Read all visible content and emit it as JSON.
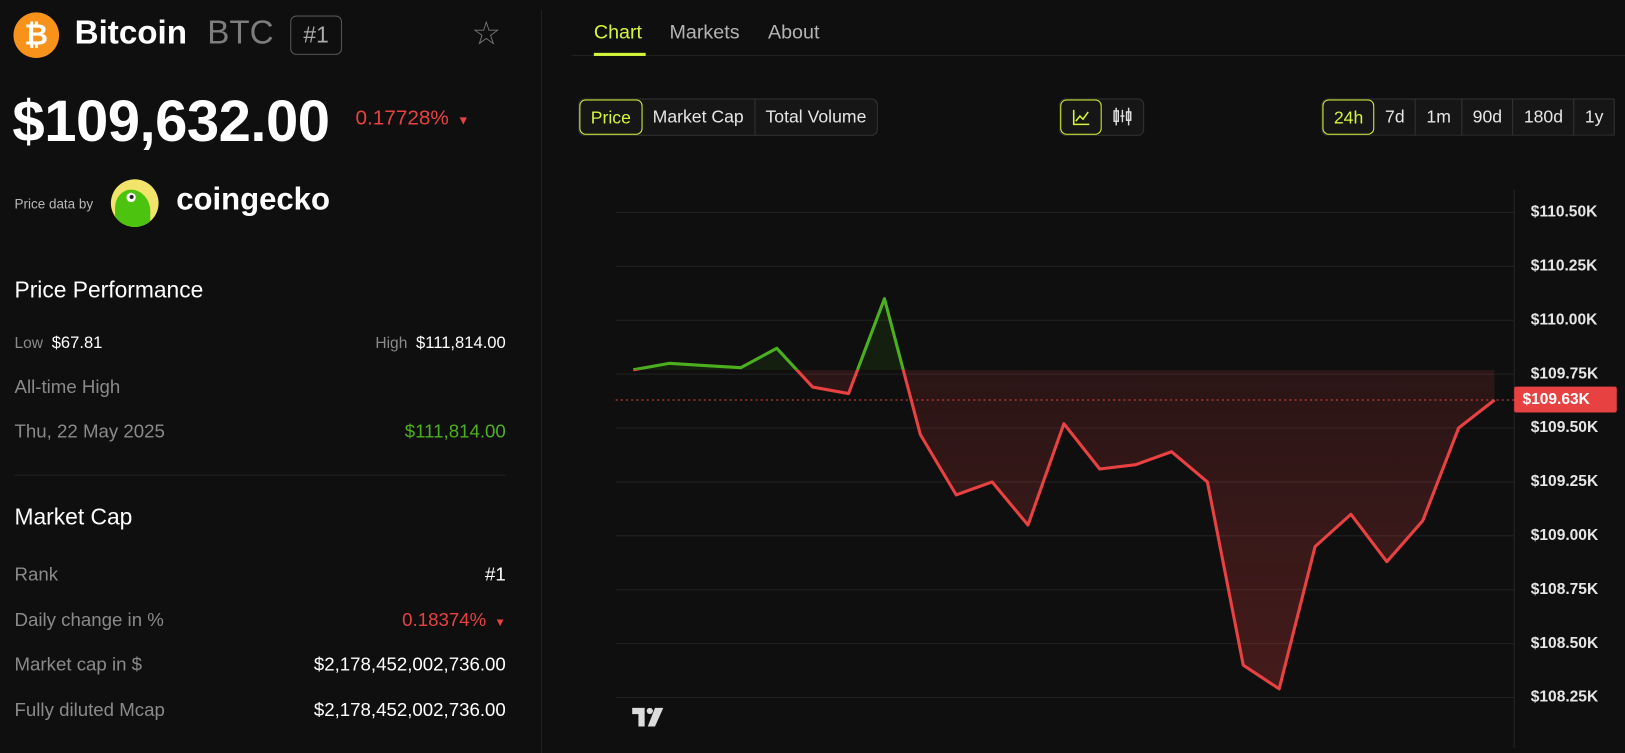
{
  "coin": {
    "name": "Bitcoin",
    "symbol": "BTC",
    "rank_badge": "#1",
    "icon": "bitcoin-icon",
    "favorite_icon": "star-icon"
  },
  "price": {
    "value": "$109,632.00",
    "change": "0.17728%",
    "change_dir": "down",
    "change_arrow": "▼"
  },
  "provider": {
    "label": "Price data by",
    "name": "coingecko"
  },
  "performance": {
    "title": "Price Performance",
    "low_label": "Low",
    "low_value": "$67.81",
    "high_label": "High",
    "high_value": "$111,814.00",
    "ath_label": "All-time High",
    "ath_date": "Thu, 22 May 2025",
    "ath_value": "$111,814.00"
  },
  "market_cap": {
    "title": "Market Cap",
    "rows": [
      {
        "label": "Rank",
        "value": "#1"
      },
      {
        "label": "Daily change in %",
        "value": "0.18374%",
        "arrow": "▼"
      },
      {
        "label": "Market cap in $",
        "value": "$2,178,452,002,736.00"
      },
      {
        "label": "Fully diluted Mcap",
        "value": "$2,178,452,002,736.00"
      }
    ]
  },
  "tabs": [
    {
      "label": "Chart",
      "active": true
    },
    {
      "label": "Markets"
    },
    {
      "label": "About"
    }
  ],
  "metric_buttons": [
    {
      "label": "Price",
      "active": true
    },
    {
      "label": "Market Cap"
    },
    {
      "label": "Total Volume"
    }
  ],
  "chart_type_buttons": [
    {
      "icon": "line-chart-icon",
      "active": true
    },
    {
      "icon": "candlestick-icon"
    }
  ],
  "period_buttons": [
    {
      "label": "24h",
      "active": true
    },
    {
      "label": "7d"
    },
    {
      "label": "1m"
    },
    {
      "label": "90d"
    },
    {
      "label": "180d"
    },
    {
      "label": "1y"
    }
  ],
  "colors": {
    "accent": "#d3f53b",
    "up": "#4caf1e",
    "down": "#e84142",
    "background": "#0f0f0f"
  },
  "chart_data": {
    "type": "area",
    "period": "24h",
    "ylim": [
      108.15,
      110.6
    ],
    "y_unit": "thousand USD",
    "y_ticks": [
      "$110.50K",
      "$110.25K",
      "$110.00K",
      "$109.75K",
      "$109.50K",
      "$109.25K",
      "$109.00K",
      "$108.75K",
      "$108.50K",
      "$108.25K"
    ],
    "y_tick_values": [
      110.5,
      110.25,
      110.0,
      109.75,
      109.5,
      109.25,
      109.0,
      108.75,
      108.5,
      108.25
    ],
    "baseline": 109.77,
    "current_label": "$109.63K",
    "current_value": 109.63,
    "values": [
      109.77,
      109.8,
      109.79,
      109.78,
      109.87,
      109.69,
      109.66,
      110.1,
      109.47,
      109.19,
      109.25,
      109.05,
      109.52,
      109.31,
      109.33,
      109.39,
      109.25,
      108.4,
      108.29,
      108.95,
      109.1,
      108.88,
      109.07,
      109.5,
      109.63
    ],
    "grid": true,
    "watermark": "TradingView"
  }
}
